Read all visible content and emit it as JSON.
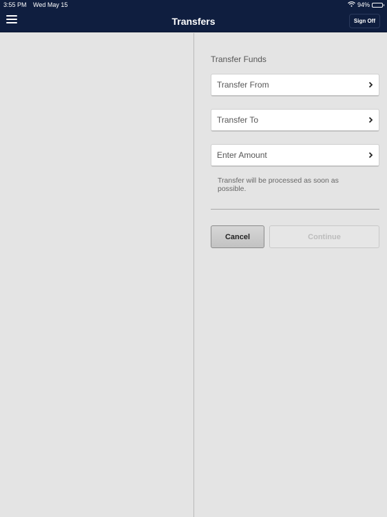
{
  "status_bar": {
    "time": "3:55 PM",
    "date": "Wed May 15",
    "battery_percent": "94%",
    "battery_level": 0.94,
    "wifi_icon": "wifi-icon",
    "battery_icon": "battery-icon"
  },
  "header": {
    "title": "Transfers",
    "menu_icon": "hamburger-icon",
    "sign_off_label": "Sign Off",
    "background_color": "#0f1e3f"
  },
  "form": {
    "section_label": "Transfer Funds",
    "rows": [
      {
        "label": "Transfer From",
        "icon": "chevron-right-icon"
      },
      {
        "label": "Transfer To",
        "icon": "chevron-right-icon"
      },
      {
        "label": "Enter Amount",
        "icon": "chevron-right-icon"
      }
    ],
    "note": "Transfer will be processed as soon as possible.",
    "cancel_label": "Cancel",
    "continue_label": "Continue",
    "continue_enabled": false
  }
}
